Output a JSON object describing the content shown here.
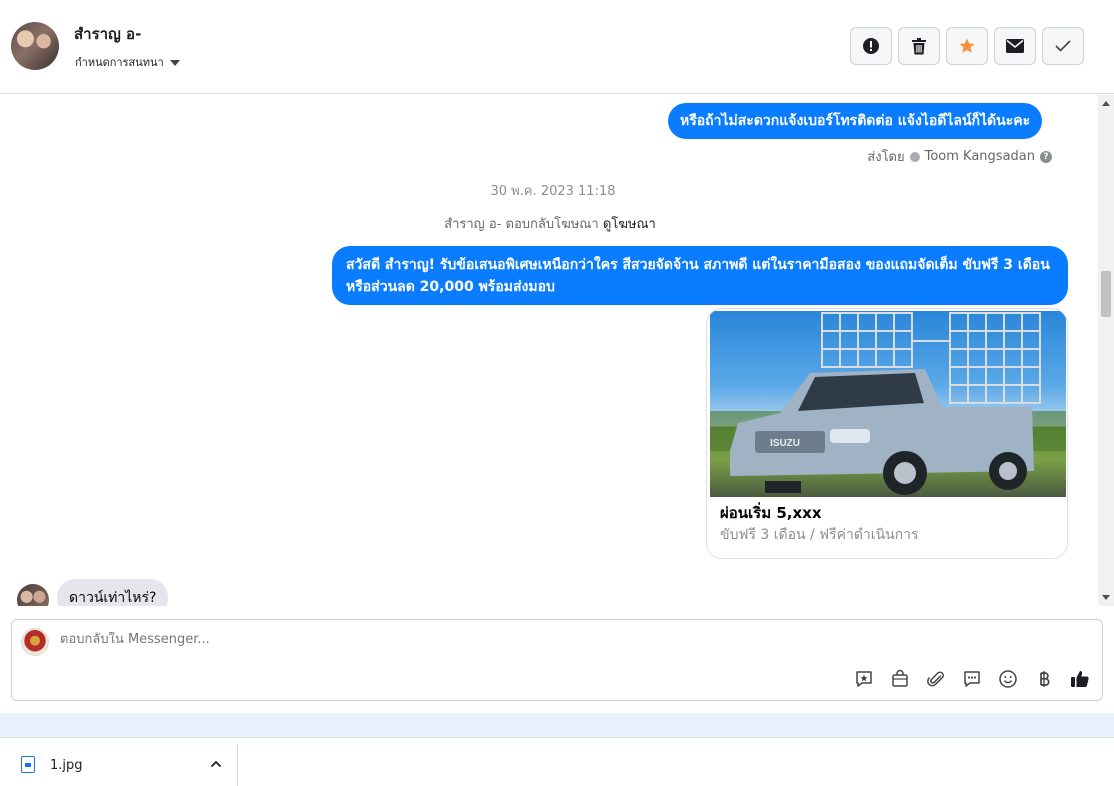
{
  "header": {
    "contact_name": "สำราญ อ-",
    "assign_label": "กำหนดการสนทนา",
    "actions": [
      "spam-icon",
      "trash-icon",
      "star-icon",
      "mail-icon",
      "check-icon"
    ],
    "star_color": "#f7923b"
  },
  "messages": {
    "out1": "หรือถ้าไม่สะดวกแจ้งเบอร์โทรติดต่อ แจ้งไอดีไลน์ก็ได้นะคะ",
    "sent_by_label": "ส่งโดย",
    "sent_by_name": "Toom Kangsadan",
    "timestamp": "30 พ.ค. 2023 11:18",
    "ad_reply_prefix": "สำราญ อ- ตอบกลับโฆษณา",
    "ad_reply_link": "ดูโฆษณา",
    "out2": "สวัสดี สำราญ! รับข้อเสนอพิเศษเหนือกว่าใคร สีสวยจัดจ้าน สภาพดี แต่ในราคามือสอง ของแถมจัดเต็ม ขับฟรี 3 เดือน หรือส่วนลด 20,000 พร้อมส่งมอบ",
    "card_title": "ผ่อนเริ่ม 5,xxx",
    "card_subtitle": "ขับฟรี 3 เดือน / ฟรีค่าดำเนินการ",
    "card_logo": "ISUZU",
    "in1": "ดาวน์เท่าไหร่?"
  },
  "composer": {
    "placeholder": "ตอบกลับใน Messenger...",
    "tools": [
      "quick-reply-icon",
      "shop-icon",
      "attach-icon",
      "saved-replies-icon",
      "emoji-icon",
      "baht-icon",
      "like-icon"
    ]
  },
  "downloads": {
    "file_name": "1.jpg"
  },
  "colors": {
    "accent": "#0a7cff",
    "incoming_bubble": "#e4e6eb"
  }
}
